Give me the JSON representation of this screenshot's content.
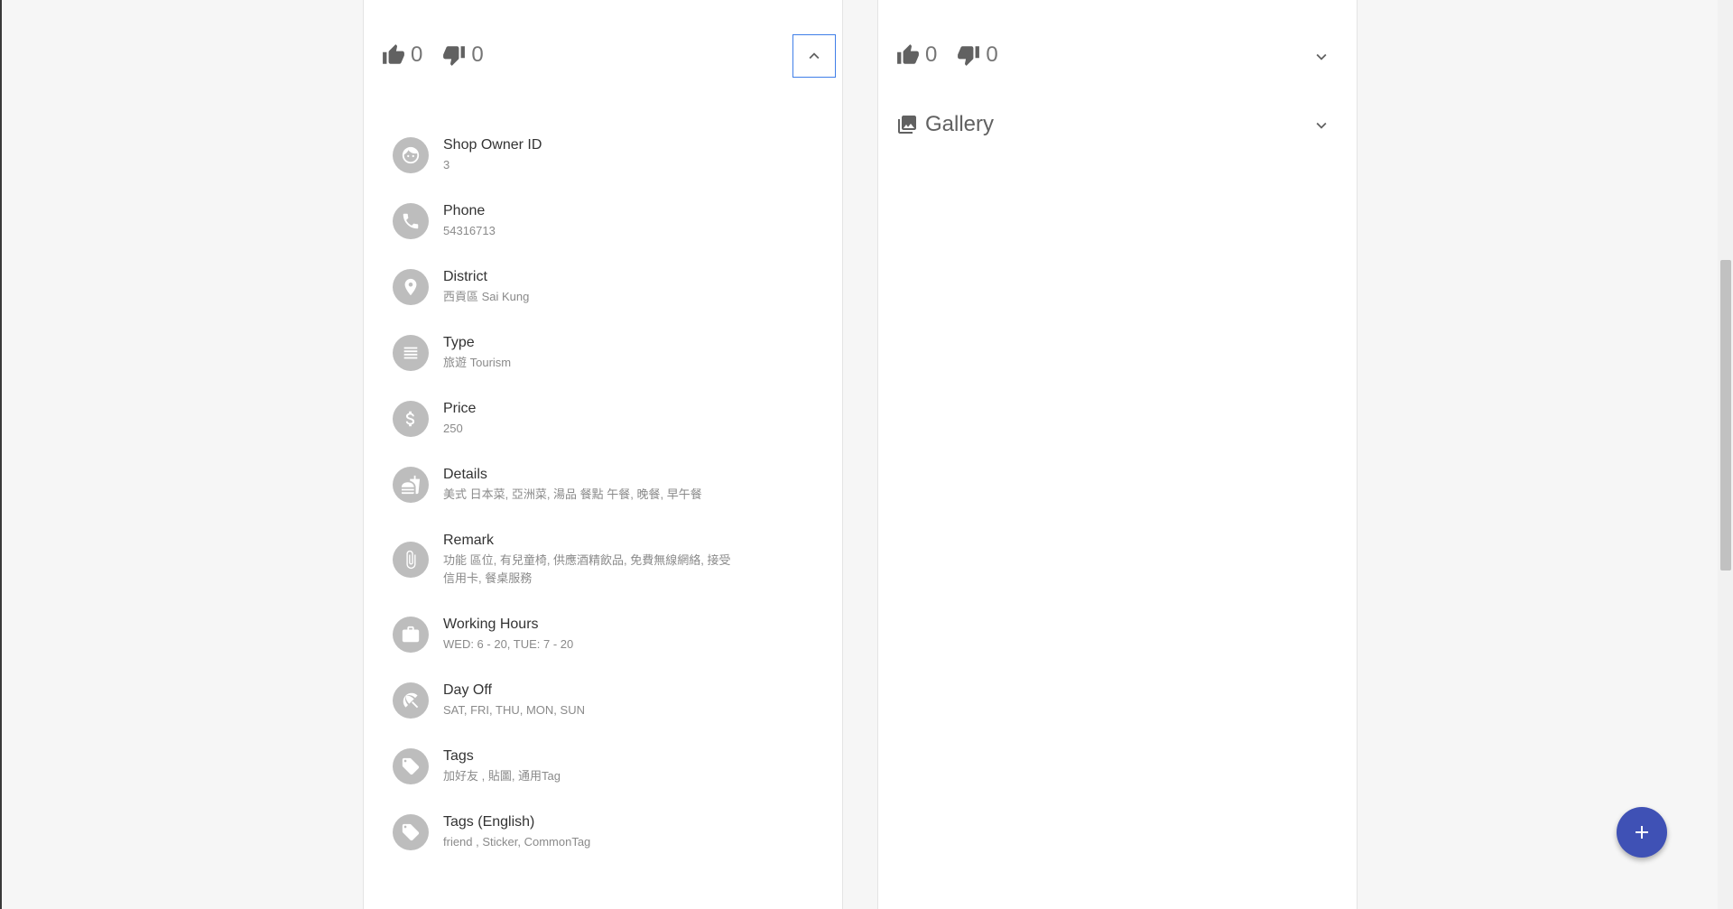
{
  "left_card": {
    "likes": "0",
    "dislikes": "0",
    "info": [
      {
        "label": "Shop Owner ID",
        "value": "3",
        "icon": "face-icon"
      },
      {
        "label": "Phone",
        "value": "54316713",
        "icon": "phone-icon"
      },
      {
        "label": "District",
        "value": "西貢區 Sai Kung",
        "icon": "location-pin-icon"
      },
      {
        "label": "Type",
        "value": "旅遊 Tourism",
        "icon": "list-lines-icon"
      },
      {
        "label": "Price",
        "value": "250",
        "icon": "dollar-icon"
      },
      {
        "label": "Details",
        "value": "美式 日本菜, 亞洲菜, 湯品 餐點 午餐, 晚餐, 早午餐",
        "icon": "fastfood-icon"
      },
      {
        "label": "Remark",
        "value": "功能 區位, 有兒童椅, 供應酒精飲品, 免費無線網絡, 接受信用卡, 餐桌服務",
        "icon": "paperclip-icon"
      },
      {
        "label": "Working Hours",
        "value": "WED: 6 - 20, TUE: 7 - 20",
        "icon": "briefcase-icon"
      },
      {
        "label": "Day Off",
        "value": "SAT, FRI, THU, MON, SUN",
        "icon": "beach-umbrella-icon"
      },
      {
        "label": "Tags",
        "value": "加好友 , 貼圖, 通用Tag",
        "icon": "tag-icon"
      },
      {
        "label": "Tags (English)",
        "value": "friend , Sticker, CommonTag",
        "icon": "tag-icon"
      }
    ]
  },
  "right_card": {
    "likes": "0",
    "dislikes": "0",
    "gallery_title": "Gallery"
  },
  "fab": {
    "icon": "plus-icon"
  },
  "colors": {
    "fab": "#3f51b5",
    "focus_border": "#3f7ee8",
    "avatar_bg": "#bdbdbd"
  }
}
